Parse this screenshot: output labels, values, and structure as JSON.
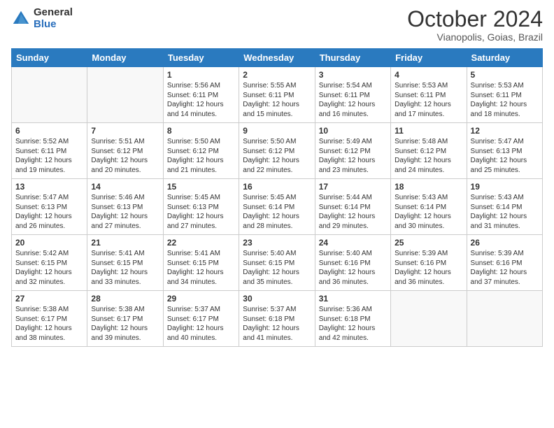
{
  "header": {
    "logo_general": "General",
    "logo_blue": "Blue",
    "month_title": "October 2024",
    "location": "Vianopolis, Goias, Brazil"
  },
  "days_of_week": [
    "Sunday",
    "Monday",
    "Tuesday",
    "Wednesday",
    "Thursday",
    "Friday",
    "Saturday"
  ],
  "weeks": [
    [
      {
        "day": "",
        "info": ""
      },
      {
        "day": "",
        "info": ""
      },
      {
        "day": "1",
        "info": "Sunrise: 5:56 AM\nSunset: 6:11 PM\nDaylight: 12 hours and 14 minutes."
      },
      {
        "day": "2",
        "info": "Sunrise: 5:55 AM\nSunset: 6:11 PM\nDaylight: 12 hours and 15 minutes."
      },
      {
        "day": "3",
        "info": "Sunrise: 5:54 AM\nSunset: 6:11 PM\nDaylight: 12 hours and 16 minutes."
      },
      {
        "day": "4",
        "info": "Sunrise: 5:53 AM\nSunset: 6:11 PM\nDaylight: 12 hours and 17 minutes."
      },
      {
        "day": "5",
        "info": "Sunrise: 5:53 AM\nSunset: 6:11 PM\nDaylight: 12 hours and 18 minutes."
      }
    ],
    [
      {
        "day": "6",
        "info": "Sunrise: 5:52 AM\nSunset: 6:11 PM\nDaylight: 12 hours and 19 minutes."
      },
      {
        "day": "7",
        "info": "Sunrise: 5:51 AM\nSunset: 6:12 PM\nDaylight: 12 hours and 20 minutes."
      },
      {
        "day": "8",
        "info": "Sunrise: 5:50 AM\nSunset: 6:12 PM\nDaylight: 12 hours and 21 minutes."
      },
      {
        "day": "9",
        "info": "Sunrise: 5:50 AM\nSunset: 6:12 PM\nDaylight: 12 hours and 22 minutes."
      },
      {
        "day": "10",
        "info": "Sunrise: 5:49 AM\nSunset: 6:12 PM\nDaylight: 12 hours and 23 minutes."
      },
      {
        "day": "11",
        "info": "Sunrise: 5:48 AM\nSunset: 6:12 PM\nDaylight: 12 hours and 24 minutes."
      },
      {
        "day": "12",
        "info": "Sunrise: 5:47 AM\nSunset: 6:13 PM\nDaylight: 12 hours and 25 minutes."
      }
    ],
    [
      {
        "day": "13",
        "info": "Sunrise: 5:47 AM\nSunset: 6:13 PM\nDaylight: 12 hours and 26 minutes."
      },
      {
        "day": "14",
        "info": "Sunrise: 5:46 AM\nSunset: 6:13 PM\nDaylight: 12 hours and 27 minutes."
      },
      {
        "day": "15",
        "info": "Sunrise: 5:45 AM\nSunset: 6:13 PM\nDaylight: 12 hours and 27 minutes."
      },
      {
        "day": "16",
        "info": "Sunrise: 5:45 AM\nSunset: 6:14 PM\nDaylight: 12 hours and 28 minutes."
      },
      {
        "day": "17",
        "info": "Sunrise: 5:44 AM\nSunset: 6:14 PM\nDaylight: 12 hours and 29 minutes."
      },
      {
        "day": "18",
        "info": "Sunrise: 5:43 AM\nSunset: 6:14 PM\nDaylight: 12 hours and 30 minutes."
      },
      {
        "day": "19",
        "info": "Sunrise: 5:43 AM\nSunset: 6:14 PM\nDaylight: 12 hours and 31 minutes."
      }
    ],
    [
      {
        "day": "20",
        "info": "Sunrise: 5:42 AM\nSunset: 6:15 PM\nDaylight: 12 hours and 32 minutes."
      },
      {
        "day": "21",
        "info": "Sunrise: 5:41 AM\nSunset: 6:15 PM\nDaylight: 12 hours and 33 minutes."
      },
      {
        "day": "22",
        "info": "Sunrise: 5:41 AM\nSunset: 6:15 PM\nDaylight: 12 hours and 34 minutes."
      },
      {
        "day": "23",
        "info": "Sunrise: 5:40 AM\nSunset: 6:15 PM\nDaylight: 12 hours and 35 minutes."
      },
      {
        "day": "24",
        "info": "Sunrise: 5:40 AM\nSunset: 6:16 PM\nDaylight: 12 hours and 36 minutes."
      },
      {
        "day": "25",
        "info": "Sunrise: 5:39 AM\nSunset: 6:16 PM\nDaylight: 12 hours and 36 minutes."
      },
      {
        "day": "26",
        "info": "Sunrise: 5:39 AM\nSunset: 6:16 PM\nDaylight: 12 hours and 37 minutes."
      }
    ],
    [
      {
        "day": "27",
        "info": "Sunrise: 5:38 AM\nSunset: 6:17 PM\nDaylight: 12 hours and 38 minutes."
      },
      {
        "day": "28",
        "info": "Sunrise: 5:38 AM\nSunset: 6:17 PM\nDaylight: 12 hours and 39 minutes."
      },
      {
        "day": "29",
        "info": "Sunrise: 5:37 AM\nSunset: 6:17 PM\nDaylight: 12 hours and 40 minutes."
      },
      {
        "day": "30",
        "info": "Sunrise: 5:37 AM\nSunset: 6:18 PM\nDaylight: 12 hours and 41 minutes."
      },
      {
        "day": "31",
        "info": "Sunrise: 5:36 AM\nSunset: 6:18 PM\nDaylight: 12 hours and 42 minutes."
      },
      {
        "day": "",
        "info": ""
      },
      {
        "day": "",
        "info": ""
      }
    ]
  ]
}
